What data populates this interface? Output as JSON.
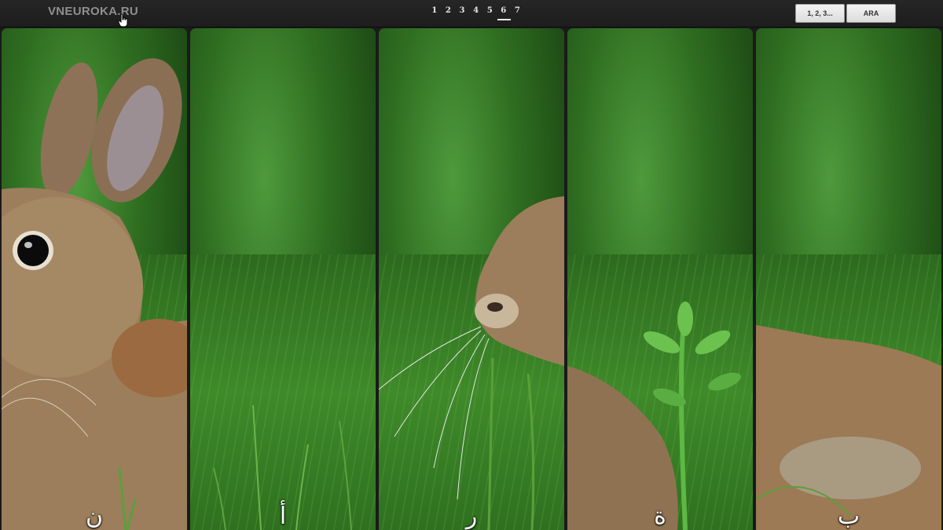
{
  "header": {
    "logo": "VNEUROKA.RU",
    "pages": [
      "1",
      "2",
      "3",
      "4",
      "5",
      "6",
      "7"
    ],
    "active_page": "6",
    "buttons": {
      "sequence_label": "1, 2, 3...",
      "language_label": "ARA"
    }
  },
  "panels": [
    {
      "letter": "ن",
      "content": "rabbit-head"
    },
    {
      "letter": "أ",
      "content": "grass"
    },
    {
      "letter": "ر",
      "content": "rabbit-nose"
    },
    {
      "letter": "ة",
      "content": "rabbit-back"
    },
    {
      "letter": "ب",
      "content": "rabbit-body"
    }
  ],
  "colors": {
    "background": "#1a1a1a",
    "logo": "#8f8f8f",
    "grass": "#3f8a2a",
    "fur": "#9c7e5c"
  }
}
